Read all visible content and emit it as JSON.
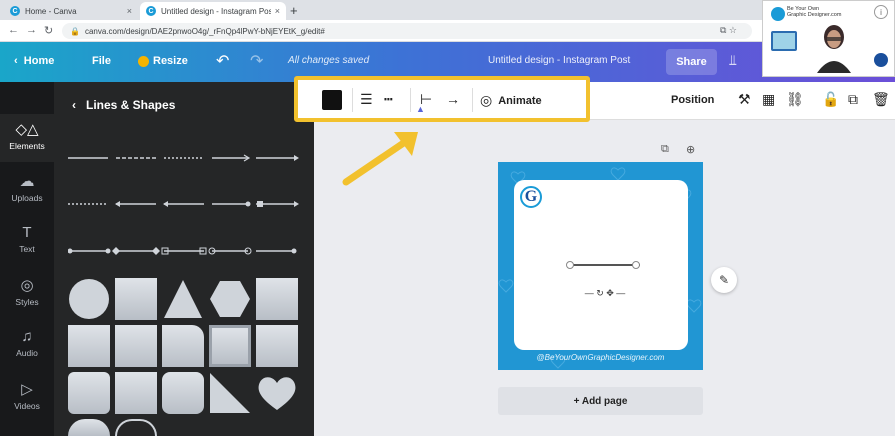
{
  "browser": {
    "tabs": [
      {
        "label": "Home - Canva",
        "close": "×"
      },
      {
        "label": "Untitled design - Instagram Post",
        "close": "×"
      }
    ],
    "new_tab": "+",
    "url": "canva.com/design/DAE2pnwoO4g/_rFnQp4lPwY-bNjEYEtK_g/edit#"
  },
  "topbar": {
    "home": "Home",
    "file": "File",
    "resize": "Resize",
    "saved": "All changes saved",
    "title": "Untitled design - Instagram Post",
    "share": "Share"
  },
  "webcam": {
    "line1": "Be Your Own",
    "line2": "Graphic Designer.com",
    "info": "i"
  },
  "rail": [
    {
      "label": "Elements",
      "icon": "elements-icon",
      "glyph": "◇△"
    },
    {
      "label": "Uploads",
      "icon": "uploads-icon",
      "glyph": "☁"
    },
    {
      "label": "Text",
      "icon": "text-icon",
      "glyph": "T"
    },
    {
      "label": "Styles",
      "icon": "styles-icon",
      "glyph": "◎"
    },
    {
      "label": "Audio",
      "icon": "audio-icon",
      "glyph": "♫"
    },
    {
      "label": "Videos",
      "icon": "videos-icon",
      "glyph": "▷"
    }
  ],
  "panel": {
    "title": "Lines & Shapes"
  },
  "toolbar": {
    "animate": "Animate",
    "position": "Position"
  },
  "design": {
    "logo_letter": "G",
    "footer": "@BeYourOwnGraphicDesigner.com",
    "add_page": "+ Add page"
  },
  "colors": {
    "highlight": "#f2c12e",
    "design_bg": "#2196d3",
    "panel_bg": "#252627"
  }
}
